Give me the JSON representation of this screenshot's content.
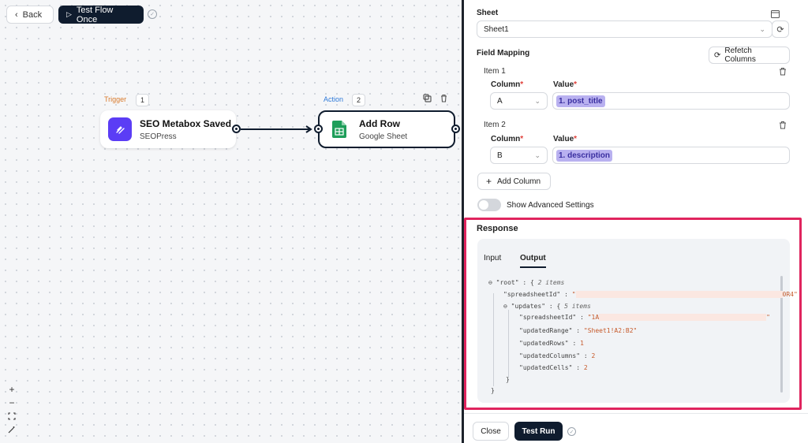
{
  "toolbar": {
    "back_label": "Back",
    "back_icon": "chevron-left-icon",
    "test_flow_label": "Test Flow Once",
    "test_flow_icon": "play-icon"
  },
  "nodes": [
    {
      "tag": "Trigger",
      "number": "1",
      "title": "SEO Metabox Saved",
      "subtitle": "SEOPress",
      "tag_color": "#d97a2b",
      "logo_color": "#5b3df5"
    },
    {
      "tag": "Action",
      "number": "2",
      "title": "Add Row",
      "subtitle": "Google Sheet",
      "tag_color": "#2f7ad8",
      "logo_color": "#1e9e5a"
    }
  ],
  "panel": {
    "sheet_label": "Sheet",
    "sheet_value": "Sheet1",
    "field_mapping_label": "Field Mapping",
    "refetch_label": "Refetch Columns",
    "items": [
      {
        "label": "Item 1",
        "column_label": "Column",
        "value_label": "Value",
        "column": "A",
        "value": "1. post_title"
      },
      {
        "label": "Item 2",
        "column_label": "Column",
        "value_label": "Value",
        "column": "B",
        "value": "1. description"
      }
    ],
    "add_column_label": "Add Column",
    "advanced_settings_label": "Show Advanced Settings",
    "advanced_settings_on": false
  },
  "response": {
    "title": "Response",
    "tabs": [
      "Input",
      "Output"
    ],
    "active_tab": "Output",
    "json": {
      "root_key": "\"root\"",
      "root_count": "2 items",
      "spreadsheet_key": "\"spreadsheetId\"",
      "spreadsheet_val_end": "0R4\"",
      "updates_key": "\"updates\"",
      "updates_count": "5 items",
      "inner_spreadsheet_key": "\"spreadsheetId\"",
      "inner_spreadsheet_val_start": "\"1A",
      "updated_range_key": "\"updatedRange\"",
      "updated_range_val": "\"Sheet1!A2:B2\"",
      "updated_rows_key": "\"updatedRows\"",
      "updated_rows_val": "1",
      "updated_columns_key": "\"updatedColumns\"",
      "updated_columns_val": "2",
      "updated_cells_key": "\"updatedCells\"",
      "updated_cells_val": "2"
    }
  },
  "footer": {
    "close_label": "Close",
    "test_run_label": "Test Run"
  },
  "colors": {
    "accent_dark": "#0f1c2e",
    "highlight_border": "#e0245e",
    "pill_bg": "#b9b1f0"
  }
}
